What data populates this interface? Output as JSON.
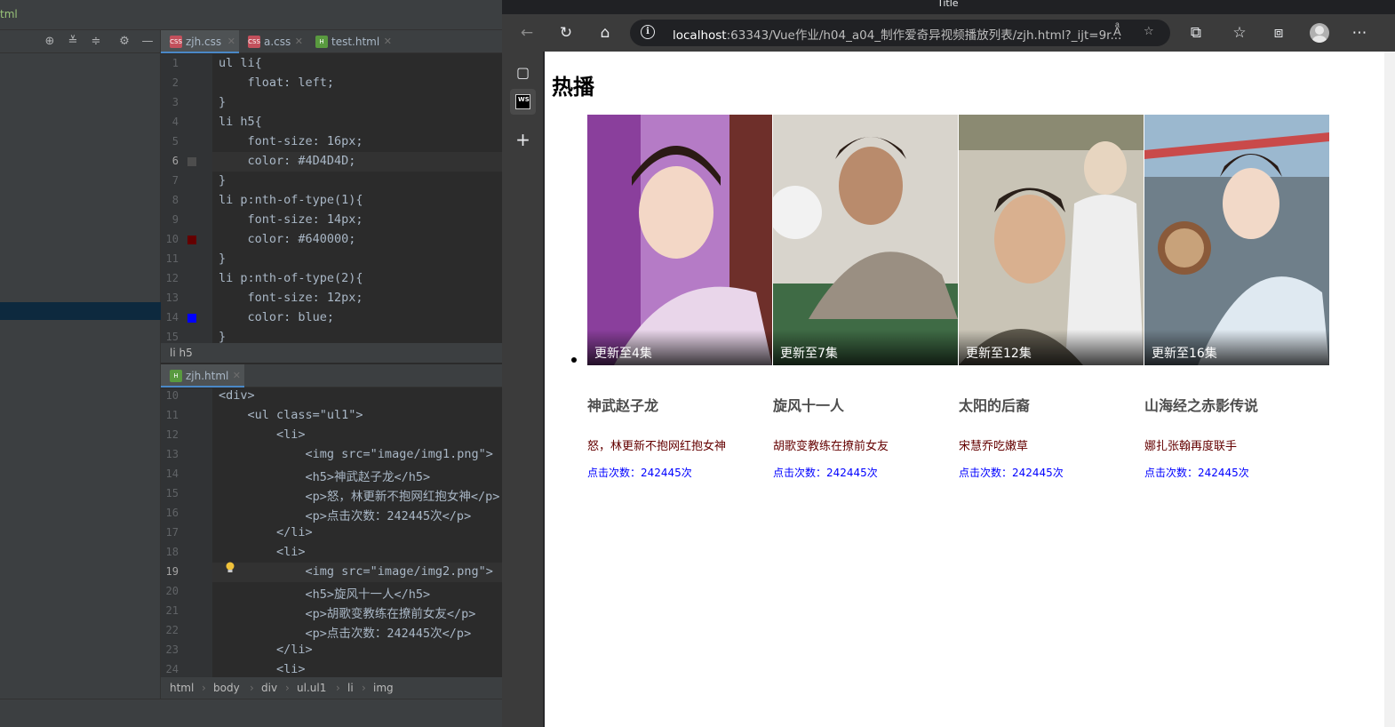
{
  "ide": {
    "top_crumb": "tml",
    "tabs": [
      {
        "label": "zjh.css",
        "type": "css",
        "active": true
      },
      {
        "label": "a.css",
        "type": "css",
        "active": false
      },
      {
        "label": "test.html",
        "type": "html",
        "active": false
      }
    ],
    "css_lines": [
      {
        "num": "1",
        "text": "ul li{"
      },
      {
        "num": "2",
        "text": "    float: left;"
      },
      {
        "num": "3",
        "text": "}"
      },
      {
        "num": "4",
        "text": "li h5{"
      },
      {
        "num": "5",
        "text": "    font-size: 16px;"
      },
      {
        "num": "6",
        "text": "    color: #4D4D4D;"
      },
      {
        "num": "7",
        "text": "}"
      },
      {
        "num": "8",
        "text": "li p:nth-of-type(1){"
      },
      {
        "num": "9",
        "text": "    font-size: 14px;"
      },
      {
        "num": "10",
        "text": "    color: #640000;"
      },
      {
        "num": "11",
        "text": "}"
      },
      {
        "num": "12",
        "text": "li p:nth-of-type(2){"
      },
      {
        "num": "13",
        "text": "    font-size: 12px;"
      },
      {
        "num": "14",
        "text": "    color: blue;"
      },
      {
        "num": "15",
        "text": "}"
      }
    ],
    "css_swatches": {
      "line6": "#4D4D4D",
      "line10": "#640000",
      "line14": "#0000ff"
    },
    "status_breadcrumb": "li h5",
    "html_tab": {
      "label": "zjh.html",
      "type": "html"
    },
    "html_lines": [
      {
        "num": "10",
        "text": "<div>"
      },
      {
        "num": "11",
        "text": "    <ul class=\"ul1\">"
      },
      {
        "num": "12",
        "text": "        <li>"
      },
      {
        "num": "13",
        "text": "            <img src=\"image/img1.png\">"
      },
      {
        "num": "14",
        "text": "            <h5>神武赵子龙</h5>"
      },
      {
        "num": "15",
        "text": "            <p>怒，林更新不抱网红抱女神</p>"
      },
      {
        "num": "16",
        "text": "            <p>点击次数：242445次</p>"
      },
      {
        "num": "17",
        "text": "        </li>"
      },
      {
        "num": "18",
        "text": "        <li>"
      },
      {
        "num": "19",
        "text": "            <img src=\"image/img2.png\">"
      },
      {
        "num": "20",
        "text": "            <h5>旋风十一人</h5>"
      },
      {
        "num": "21",
        "text": "            <p>胡歌变教练在撩前女友</p>"
      },
      {
        "num": "22",
        "text": "            <p>点击次数：242445次</p>"
      },
      {
        "num": "23",
        "text": "        </li>"
      },
      {
        "num": "24",
        "text": "        <li>"
      }
    ],
    "html_breadcrumb": [
      "html",
      "body",
      "div",
      "ul.ul1",
      "li",
      "img"
    ]
  },
  "browser": {
    "window_title": "Title",
    "url_host": "localhost",
    "url_rest": ":63343/Vue作业/h04_a04_制作爱奇异视频播放列表/zjh.html?_ijt=9r...",
    "nav_icons": [
      "back-icon",
      "refresh-icon",
      "home-icon"
    ],
    "page": {
      "heading": "热播",
      "items": [
        {
          "badge": "更新至4集",
          "title": "神武赵子龙",
          "desc": "怒，林更新不抱网红抱女神",
          "clicks": "点击次数：242445次",
          "thumb_colors": [
            "#b57bc6",
            "#e9d6ea",
            "#8a3f9c"
          ]
        },
        {
          "badge": "更新至7集",
          "title": "旋风十一人",
          "desc": "胡歌变教练在撩前女友",
          "clicks": "点击次数：242445次",
          "thumb_colors": [
            "#d8d4cc",
            "#7a6c5c",
            "#3f6b45"
          ]
        },
        {
          "badge": "更新至12集",
          "title": "太阳的后裔",
          "desc": "宋慧乔吃嫩草",
          "clicks": "点击次数：242445次",
          "thumb_colors": [
            "#c9c4b6",
            "#e7d5c0",
            "#5f5a4e"
          ]
        },
        {
          "badge": "更新至16集",
          "title": "山海经之赤影传说",
          "desc": "娜扎张翰再度联手",
          "clicks": "点击次数：242445次",
          "thumb_colors": [
            "#9bb8cf",
            "#dfe9f1",
            "#6b4c3a"
          ]
        }
      ]
    }
  }
}
